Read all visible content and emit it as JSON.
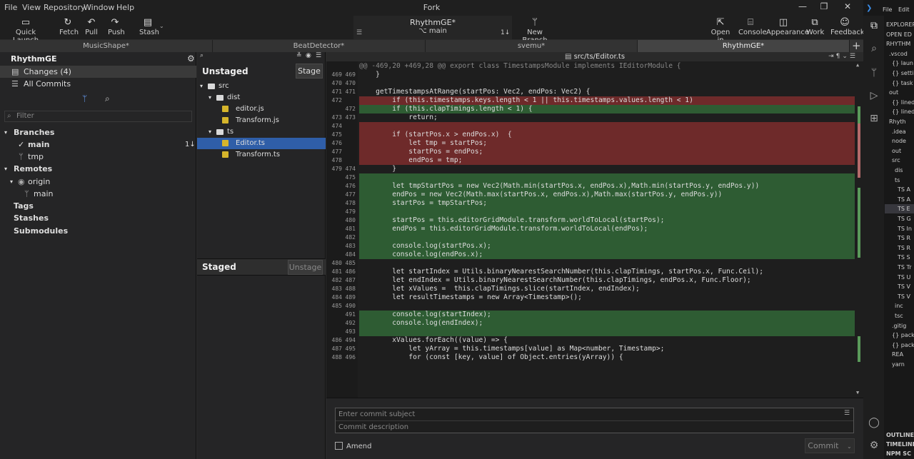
{
  "app": {
    "title": "Fork"
  },
  "menu": [
    "File",
    "View",
    "Repository",
    "Window",
    "Help"
  ],
  "toolbar": {
    "quick_launch": "Quick Launch",
    "fetch": "Fetch",
    "pull": "Pull",
    "push": "Push",
    "stash": "Stash",
    "repo_name": "RhythmGE*",
    "branch": "main",
    "ahead_behind": "1↓",
    "new_branch": "New Branch",
    "open_in": "Open in",
    "console": "Console",
    "appearance": "Appearance",
    "work": "Work",
    "feedback": "Feedback"
  },
  "tabs": [
    "MusicShape*",
    "BeatDetector*",
    "svemu*",
    "RhythmGE*"
  ],
  "sidebar": {
    "repo": "RhythmGE",
    "changes": "Changes (4)",
    "all_commits": "All Commits",
    "filter_placeholder": "Filter",
    "branches": "Branches",
    "branch_main": "main",
    "branch_main_badge": "1↓",
    "branch_tmp": "tmp",
    "remotes": "Remotes",
    "origin": "origin",
    "origin_main": "main",
    "tags": "Tags",
    "stashes": "Stashes",
    "submodules": "Submodules"
  },
  "unstaged": {
    "title": "Unstaged",
    "stage_btn": "Stage",
    "tree": [
      {
        "label": "src",
        "indent": 0,
        "kind": "folder"
      },
      {
        "label": "dist",
        "indent": 1,
        "kind": "folder"
      },
      {
        "label": "editor.js",
        "indent": 2,
        "kind": "file"
      },
      {
        "label": "Transform.js",
        "indent": 2,
        "kind": "file"
      },
      {
        "label": "ts",
        "indent": 1,
        "kind": "folder"
      },
      {
        "label": "Editor.ts",
        "indent": 2,
        "kind": "file",
        "selected": true
      },
      {
        "label": "Transform.ts",
        "indent": 2,
        "kind": "file"
      }
    ]
  },
  "staged": {
    "title": "Staged",
    "unstage_btn": "Unstage"
  },
  "diff": {
    "file": "src/ts/Editor.ts",
    "lines": [
      {
        "o": "",
        "n": "",
        "t": "hunk",
        "c": "@@ -469,20 +469,28 @@ export class TimestampsModule implements IEditorModule {"
      },
      {
        "o": "469",
        "n": "469",
        "t": "ctx",
        "c": "    }"
      },
      {
        "o": "470",
        "n": "470",
        "t": "ctx",
        "c": ""
      },
      {
        "o": "471",
        "n": "471",
        "t": "ctx",
        "c": "    getTimestampsAtRange(startPos: Vec2, endPos: Vec2) {"
      },
      {
        "o": "472",
        "n": "",
        "t": "del",
        "c": "        if (this.timestamps.keys.length < 1 || this.timestamps.values.length < 1)"
      },
      {
        "o": "",
        "n": "472",
        "t": "add",
        "c": "        if (this.clapTimings.length < 1) {"
      },
      {
        "o": "473",
        "n": "473",
        "t": "ctx",
        "c": "            return;"
      },
      {
        "o": "474",
        "n": "",
        "t": "del",
        "c": ""
      },
      {
        "o": "475",
        "n": "",
        "t": "del",
        "c": "        if (startPos.x > endPos.x)  {"
      },
      {
        "o": "476",
        "n": "",
        "t": "del",
        "c": "            let tmp = startPos;"
      },
      {
        "o": "477",
        "n": "",
        "t": "del",
        "c": "            startPos = endPos;"
      },
      {
        "o": "478",
        "n": "",
        "t": "del",
        "c": "            endPos = tmp;"
      },
      {
        "o": "479",
        "n": "474",
        "t": "ctx",
        "c": "        }"
      },
      {
        "o": "",
        "n": "475",
        "t": "add",
        "c": ""
      },
      {
        "o": "",
        "n": "476",
        "t": "add",
        "c": "        let tmpStartPos = new Vec2(Math.min(startPos.x, endPos.x),Math.min(startPos.y, endPos.y))"
      },
      {
        "o": "",
        "n": "477",
        "t": "add",
        "c": "        endPos = new Vec2(Math.max(startPos.x, endPos.x),Math.max(startPos.y, endPos.y))"
      },
      {
        "o": "",
        "n": "478",
        "t": "add",
        "c": "        startPos = tmpStartPos;"
      },
      {
        "o": "",
        "n": "479",
        "t": "add",
        "c": ""
      },
      {
        "o": "",
        "n": "480",
        "t": "add",
        "c": "        startPos = this.editorGridModule.transform.worldToLocal(startPos);"
      },
      {
        "o": "",
        "n": "481",
        "t": "add",
        "c": "        endPos = this.editorGridModule.transform.worldToLocal(endPos);"
      },
      {
        "o": "",
        "n": "482",
        "t": "add",
        "c": ""
      },
      {
        "o": "",
        "n": "483",
        "t": "add",
        "c": "        console.log(startPos.x);"
      },
      {
        "o": "",
        "n": "484",
        "t": "add",
        "c": "        console.log(endPos.x);"
      },
      {
        "o": "480",
        "n": "485",
        "t": "ctx",
        "c": ""
      },
      {
        "o": "481",
        "n": "486",
        "t": "ctx",
        "c": "        let startIndex = Utils.binaryNearestSearchNumber(this.clapTimings, startPos.x, Func.Ceil);"
      },
      {
        "o": "482",
        "n": "487",
        "t": "ctx",
        "c": "        let endIndex = Utils.binaryNearestSearchNumber(this.clapTimings, endPos.x, Func.Floor);"
      },
      {
        "o": "483",
        "n": "488",
        "t": "ctx",
        "c": "        let xValues =  this.clapTimings.slice(startIndex, endIndex);"
      },
      {
        "o": "484",
        "n": "489",
        "t": "ctx",
        "c": "        let resultTimestamps = new Array<Timestamp>();"
      },
      {
        "o": "485",
        "n": "490",
        "t": "ctx",
        "c": ""
      },
      {
        "o": "",
        "n": "491",
        "t": "add",
        "c": "        console.log(startIndex);"
      },
      {
        "o": "",
        "n": "492",
        "t": "add",
        "c": "        console.log(endIndex);"
      },
      {
        "o": "",
        "n": "493",
        "t": "add",
        "c": ""
      },
      {
        "o": "486",
        "n": "494",
        "t": "ctx",
        "c": "        xValues.forEach((value) => {"
      },
      {
        "o": "487",
        "n": "495",
        "t": "ctx",
        "c": "            let yArray = this.timestamps[value] as Map<number, Timestamp>;"
      },
      {
        "o": "488",
        "n": "496",
        "t": "ctx",
        "c": "            for (const [key, value] of Object.entries(yArray)) {"
      }
    ]
  },
  "commit": {
    "subject_placeholder": "Enter commit subject",
    "description_placeholder": "Commit description",
    "amend": "Amend",
    "commit_btn": "Commit"
  },
  "vscode": {
    "menu": [
      "File",
      "Edit"
    ],
    "rows": [
      {
        "label": "EXPLORER",
        "x": 2
      },
      {
        "label": "OPEN ED",
        "x": 2
      },
      {
        "label": "RHYTHM",
        "x": 2
      },
      {
        "label": ".vscod",
        "x": 6
      },
      {
        "label": "{} laun",
        "x": 10
      },
      {
        "label": "{} setti",
        "x": 10
      },
      {
        "label": "{} task",
        "x": 10
      },
      {
        "label": "out",
        "x": 6
      },
      {
        "label": "{} lined",
        "x": 10
      },
      {
        "label": "{} lined",
        "x": 10
      },
      {
        "label": "Rhyth",
        "x": 6
      },
      {
        "label": ".idea",
        "x": 10
      },
      {
        "label": "node",
        "x": 10
      },
      {
        "label": "out",
        "x": 10
      },
      {
        "label": "src",
        "x": 10
      },
      {
        "label": "dis",
        "x": 14
      },
      {
        "label": "ts",
        "x": 14
      },
      {
        "label": "TS A",
        "x": 18
      },
      {
        "label": "TS A",
        "x": 18
      },
      {
        "label": "TS E",
        "x": 18,
        "hl": true
      },
      {
        "label": "TS G",
        "x": 18
      },
      {
        "label": "TS In",
        "x": 18
      },
      {
        "label": "TS R",
        "x": 18
      },
      {
        "label": "TS R",
        "x": 18
      },
      {
        "label": "TS S",
        "x": 18
      },
      {
        "label": "TS Tr",
        "x": 18
      },
      {
        "label": "TS U",
        "x": 18
      },
      {
        "label": "TS V",
        "x": 18
      },
      {
        "label": "TS V",
        "x": 18
      },
      {
        "label": "inc",
        "x": 14
      },
      {
        "label": "tsc",
        "x": 14
      },
      {
        "label": ".gitig",
        "x": 10
      },
      {
        "label": "{} pack",
        "x": 10
      },
      {
        "label": "{} pack",
        "x": 10
      },
      {
        "label": "REA",
        "x": 10
      },
      {
        "label": "yarn",
        "x": 10
      }
    ],
    "bottom": [
      "OUTLINE",
      "TIMELINE",
      "NPM SC"
    ]
  }
}
